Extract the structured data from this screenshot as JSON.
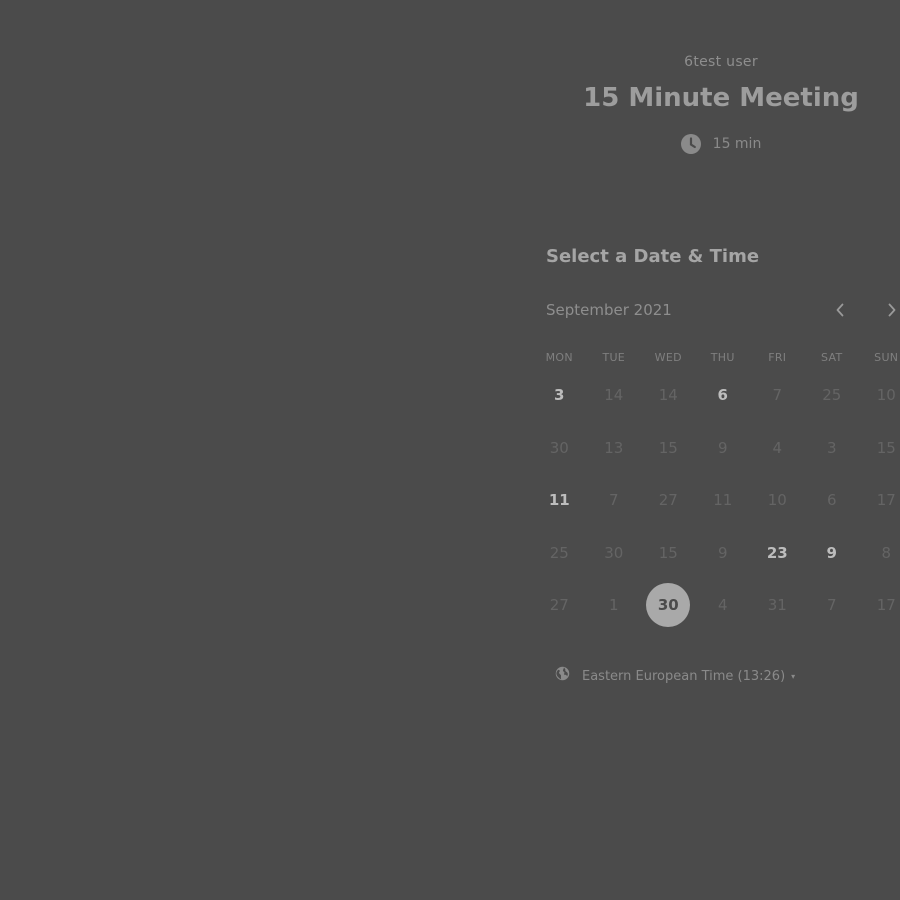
{
  "header": {
    "organizer": "6test user",
    "event_title": "15 Minute Meeting",
    "duration": "15 min",
    "duration_icon": "clock-icon"
  },
  "calendar": {
    "section_title": "Select a Date & Time",
    "month": "September 2021",
    "prev_icon": "chevron-left-icon",
    "next_icon": "chevron-right-icon",
    "weekdays": [
      "MON",
      "TUE",
      "WED",
      "THU",
      "FRI",
      "SAT",
      "SUN"
    ],
    "days": [
      {
        "label": "3",
        "state": "available"
      },
      {
        "label": "14",
        "state": "disabled"
      },
      {
        "label": "14",
        "state": "disabled"
      },
      {
        "label": "6",
        "state": "available"
      },
      {
        "label": "7",
        "state": "disabled"
      },
      {
        "label": "25",
        "state": "disabled"
      },
      {
        "label": "10",
        "state": "disabled"
      },
      {
        "label": "30",
        "state": "disabled"
      },
      {
        "label": "13",
        "state": "disabled"
      },
      {
        "label": "15",
        "state": "disabled"
      },
      {
        "label": "9",
        "state": "disabled"
      },
      {
        "label": "4",
        "state": "disabled"
      },
      {
        "label": "3",
        "state": "disabled"
      },
      {
        "label": "15",
        "state": "disabled"
      },
      {
        "label": "11",
        "state": "available"
      },
      {
        "label": "7",
        "state": "disabled"
      },
      {
        "label": "27",
        "state": "disabled"
      },
      {
        "label": "11",
        "state": "disabled"
      },
      {
        "label": "10",
        "state": "disabled"
      },
      {
        "label": "6",
        "state": "disabled"
      },
      {
        "label": "17",
        "state": "disabled"
      },
      {
        "label": "25",
        "state": "disabled"
      },
      {
        "label": "30",
        "state": "disabled"
      },
      {
        "label": "15",
        "state": "disabled"
      },
      {
        "label": "9",
        "state": "disabled"
      },
      {
        "label": "23",
        "state": "available"
      },
      {
        "label": "9",
        "state": "available"
      },
      {
        "label": "8",
        "state": "disabled"
      },
      {
        "label": "27",
        "state": "disabled"
      },
      {
        "label": "1",
        "state": "disabled"
      },
      {
        "label": "30",
        "state": "selected"
      },
      {
        "label": "4",
        "state": "disabled"
      },
      {
        "label": "31",
        "state": "disabled"
      },
      {
        "label": "7",
        "state": "disabled"
      },
      {
        "label": "17",
        "state": "disabled"
      }
    ]
  },
  "timezone": {
    "label": "Eastern European Time (13:26)",
    "icon": "globe-icon",
    "caret": "▾"
  },
  "colors": {
    "background": "#4b4b4b",
    "selected_day_bg": "#a9a9a9"
  }
}
